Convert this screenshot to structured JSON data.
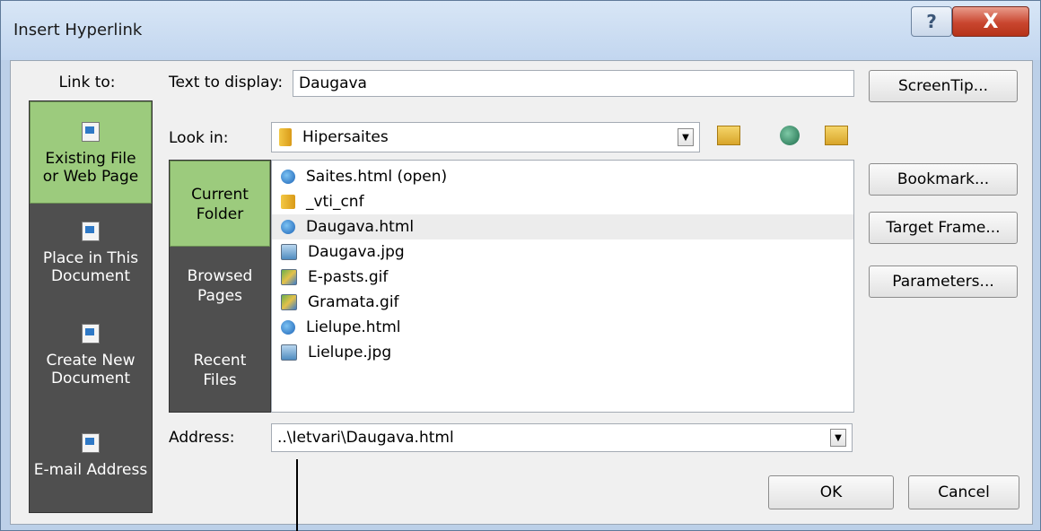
{
  "window": {
    "title": "Insert Hyperlink",
    "help_label": "?",
    "close_label": "X"
  },
  "link_to": {
    "label": "Link to:",
    "items": [
      {
        "label": "Existing File or Web Page",
        "selected": true
      },
      {
        "label": "Place in This Document",
        "selected": false
      },
      {
        "label": "Create New Document",
        "selected": false
      },
      {
        "label": "E-mail Address",
        "selected": false
      }
    ]
  },
  "text_to_display": {
    "label": "Text to display:",
    "value": "Daugava"
  },
  "look_in": {
    "label": "Look in:",
    "value": "Hipersaites"
  },
  "tools": {
    "up_folder": "up-folder-icon",
    "browse_web": "browse-web-icon",
    "browse_file": "browse-file-icon"
  },
  "subnav": {
    "items": [
      {
        "label": "Current Folder",
        "selected": true
      },
      {
        "label": "Browsed Pages",
        "selected": false
      },
      {
        "label": "Recent Files",
        "selected": false
      }
    ]
  },
  "files": [
    {
      "name": "Saites.html (open)",
      "icon": "ie"
    },
    {
      "name": "_vti_cnf",
      "icon": "folder"
    },
    {
      "name": "Daugava.html",
      "icon": "ie",
      "highlighted": true
    },
    {
      "name": "Daugava.jpg",
      "icon": "jpg"
    },
    {
      "name": "E-pasts.gif",
      "icon": "gif"
    },
    {
      "name": "Gramata.gif",
      "icon": "gif"
    },
    {
      "name": "Lielupe.html",
      "icon": "ie"
    },
    {
      "name": "Lielupe.jpg",
      "icon": "jpg"
    }
  ],
  "address": {
    "label": "Address:",
    "value": "..\\Ietvari\\Daugava.html"
  },
  "buttons": {
    "screentip": "ScreenTip...",
    "bookmark": "Bookmark...",
    "target_frame": "Target Frame...",
    "parameters": "Parameters...",
    "ok": "OK",
    "cancel": "Cancel"
  }
}
